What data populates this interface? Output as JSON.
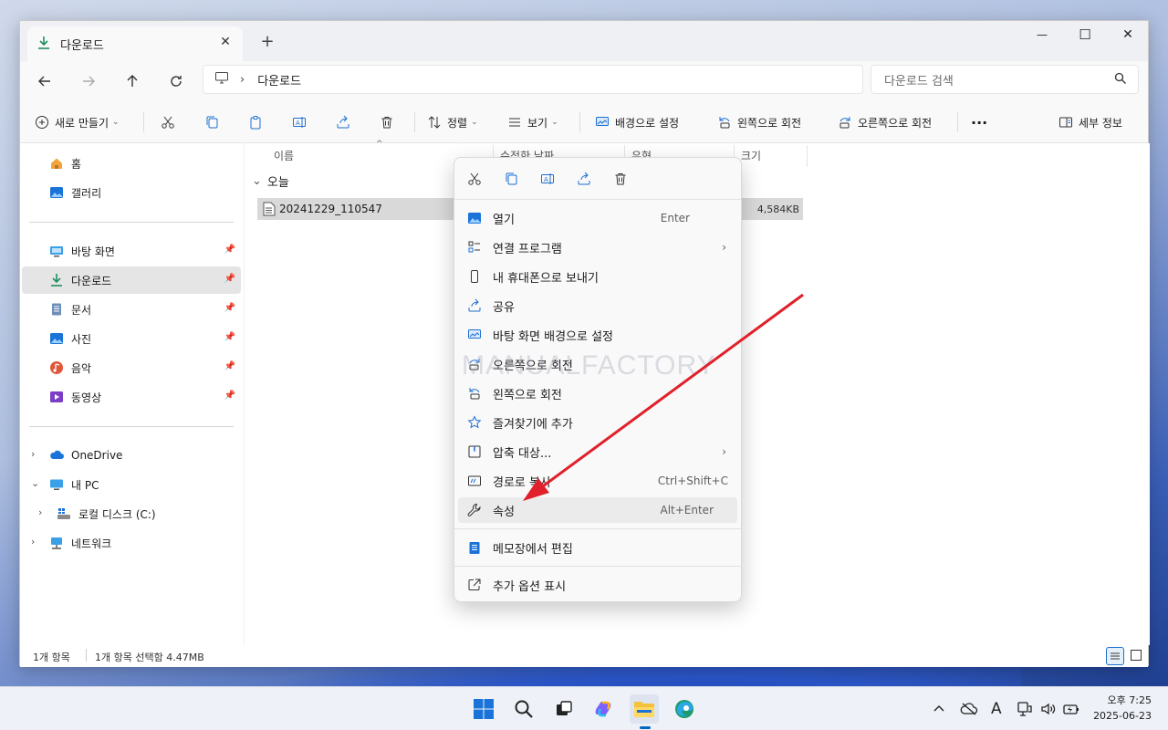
{
  "window": {
    "tab_title": "다운로드",
    "new_tab": "+",
    "controls": {
      "minimize": "—",
      "maximize": "☐",
      "close": "✕"
    }
  },
  "address": {
    "path": "다운로드",
    "search_placeholder": "다운로드 검색"
  },
  "toolbar": {
    "new_label": "새로 만들기",
    "sort_label": "정렬",
    "view_label": "보기",
    "set_bg_label": "배경으로 설정",
    "rotate_left_label": "왼쪽으로 회전",
    "rotate_right_label": "오른쪽으로 회전",
    "more_label": "···",
    "details_label": "세부 정보"
  },
  "sidebar": {
    "items": [
      {
        "label": "홈"
      },
      {
        "label": "갤러리"
      },
      {
        "label": "바탕 화면"
      },
      {
        "label": "다운로드"
      },
      {
        "label": "문서"
      },
      {
        "label": "사진"
      },
      {
        "label": "음악"
      },
      {
        "label": "동영상"
      },
      {
        "label": "OneDrive"
      },
      {
        "label": "내 PC"
      },
      {
        "label": "로컬 디스크 (C:)"
      },
      {
        "label": "네트워크"
      }
    ]
  },
  "content": {
    "columns": [
      "이름",
      "수정한 날짜",
      "유형",
      "크기"
    ],
    "group_label": "오늘",
    "file": {
      "name": "20241229_110547",
      "size": "4,584KB"
    }
  },
  "status": {
    "count": "1개 항목",
    "selected": "1개 항목 선택함 4.47MB"
  },
  "context_menu": {
    "items": [
      {
        "label": "열기",
        "shortcut": "Enter"
      },
      {
        "label": "연결 프로그램",
        "submenu": "›"
      },
      {
        "label": "내 휴대폰으로 보내기"
      },
      {
        "label": "공유"
      },
      {
        "label": "바탕 화면 배경으로 설정"
      },
      {
        "label": "오른쪽으로 회전"
      },
      {
        "label": "왼쪽으로 회전"
      },
      {
        "label": "즐겨찾기에 추가"
      },
      {
        "label": "압축 대상...",
        "submenu": "›"
      },
      {
        "label": "경로로 복사",
        "shortcut": "Ctrl+Shift+C"
      },
      {
        "label": "속성",
        "shortcut": "Alt+Enter"
      },
      {
        "label": "메모장에서 편집"
      },
      {
        "label": "추가 옵션 표시"
      }
    ]
  },
  "watermark": "MANUALFACTORY",
  "taskbar": {
    "clock_time": "오후 7:25",
    "clock_date": "2025-06-23",
    "ime_label": "A"
  },
  "colors": {
    "accent": "#0067c0",
    "arrow": "#e0212b",
    "selection": "#d9d9d9"
  }
}
